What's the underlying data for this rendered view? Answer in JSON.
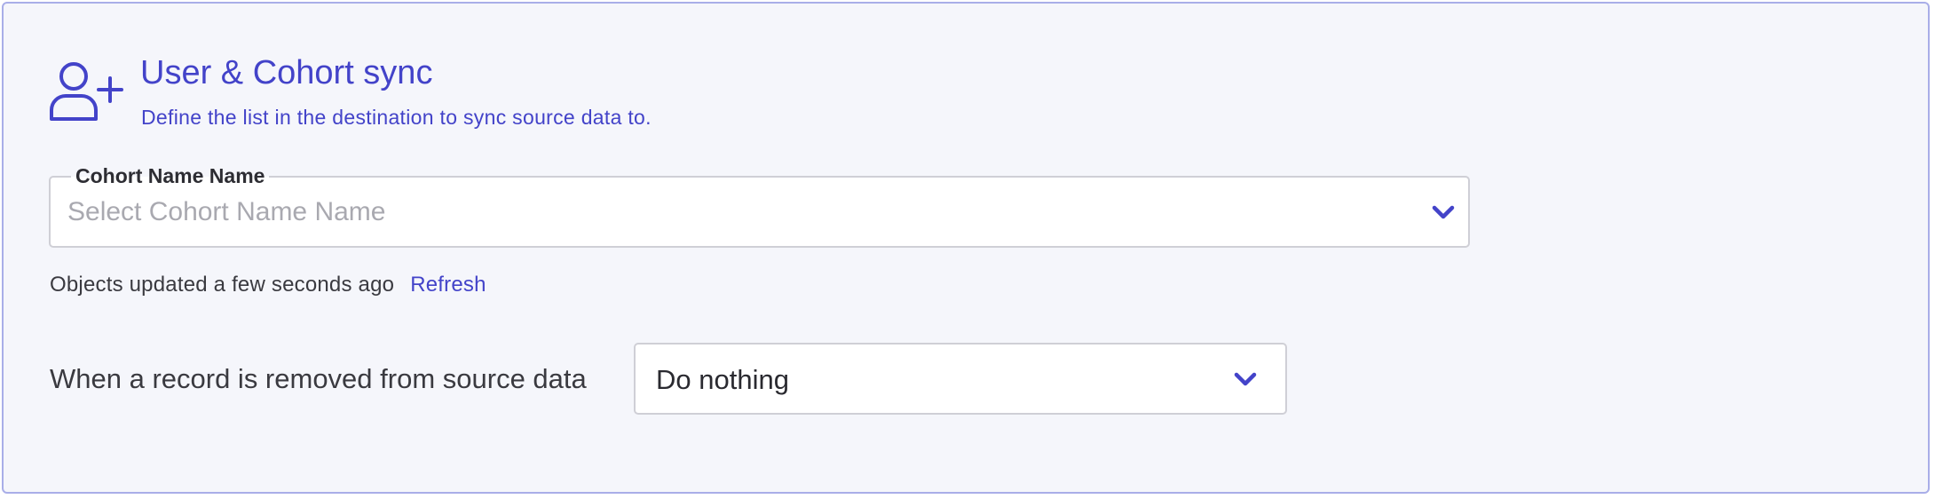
{
  "header": {
    "icon": "user-plus-icon",
    "title": "User & Cohort sync",
    "subtitle": "Define the list in the destination to sync source data to."
  },
  "cohort_field": {
    "label": "Cohort Name Name",
    "placeholder": "Select Cohort Name Name",
    "icon": "chevron-down-icon"
  },
  "status": {
    "text": "Objects updated a few seconds ago",
    "refresh_label": "Refresh"
  },
  "removal_setting": {
    "label": "When a record is removed from source data",
    "selected_value": "Do nothing",
    "icon": "chevron-down-icon"
  },
  "colors": {
    "accent": "#4343c9",
    "panel_background": "#f5f6fb",
    "panel_border": "#a9aee8",
    "input_border": "#cfcfd6",
    "placeholder": "#a9a9b0",
    "body_text": "#3a3a40"
  }
}
